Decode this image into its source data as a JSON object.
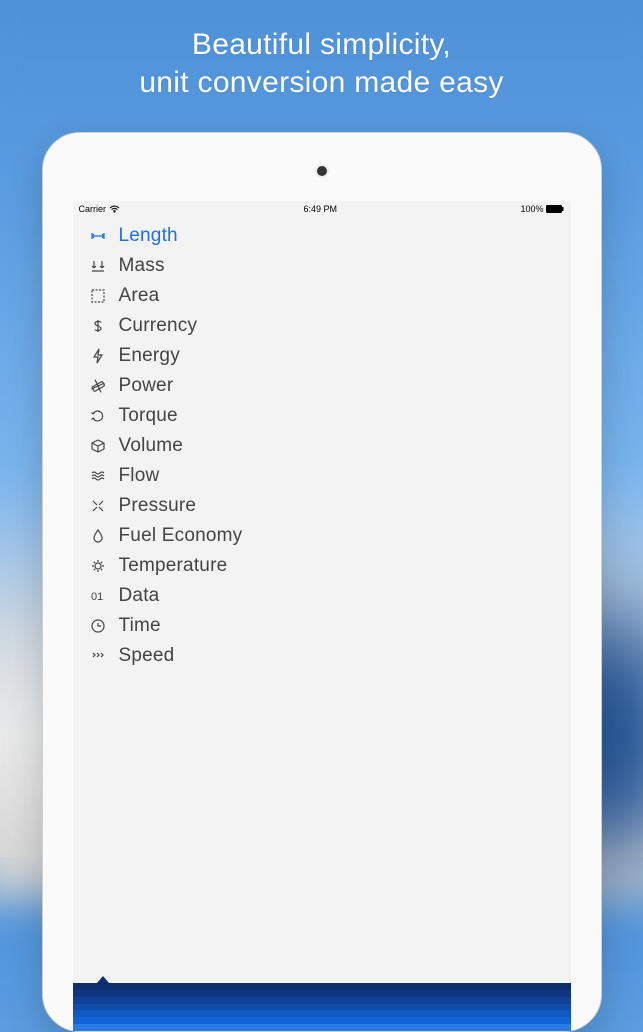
{
  "promo": {
    "line1": "Beautiful simplicity,",
    "line2": "unit conversion made easy"
  },
  "status": {
    "carrier": "Carrier",
    "time": "6:49 PM",
    "battery": "100%"
  },
  "categories": [
    {
      "id": "length",
      "label": "Length",
      "icon": "length-icon",
      "selected": true
    },
    {
      "id": "mass",
      "label": "Mass",
      "icon": "mass-icon",
      "selected": false
    },
    {
      "id": "area",
      "label": "Area",
      "icon": "area-icon",
      "selected": false
    },
    {
      "id": "currency",
      "label": "Currency",
      "icon": "currency-icon",
      "selected": false
    },
    {
      "id": "energy",
      "label": "Energy",
      "icon": "energy-icon",
      "selected": false
    },
    {
      "id": "power",
      "label": "Power",
      "icon": "power-icon",
      "selected": false
    },
    {
      "id": "torque",
      "label": "Torque",
      "icon": "torque-icon",
      "selected": false
    },
    {
      "id": "volume",
      "label": "Volume",
      "icon": "volume-icon",
      "selected": false
    },
    {
      "id": "flow",
      "label": "Flow",
      "icon": "flow-icon",
      "selected": false
    },
    {
      "id": "pressure",
      "label": "Pressure",
      "icon": "pressure-icon",
      "selected": false
    },
    {
      "id": "fuel-economy",
      "label": "Fuel Economy",
      "icon": "fuel-icon",
      "selected": false
    },
    {
      "id": "temperature",
      "label": "Temperature",
      "icon": "temperature-icon",
      "selected": false
    },
    {
      "id": "data",
      "label": "Data",
      "icon": "data-icon",
      "selected": false
    },
    {
      "id": "time",
      "label": "Time",
      "icon": "time-icon",
      "selected": false
    },
    {
      "id": "speed",
      "label": "Speed",
      "icon": "speed-icon",
      "selected": false
    }
  ],
  "accent_color": "#1f6fe8",
  "band_colors": [
    "#0d2e6a",
    "#0e377f",
    "#0f4296",
    "#104dab",
    "#1158c2",
    "#1263d8",
    "#2a7ae6"
  ]
}
